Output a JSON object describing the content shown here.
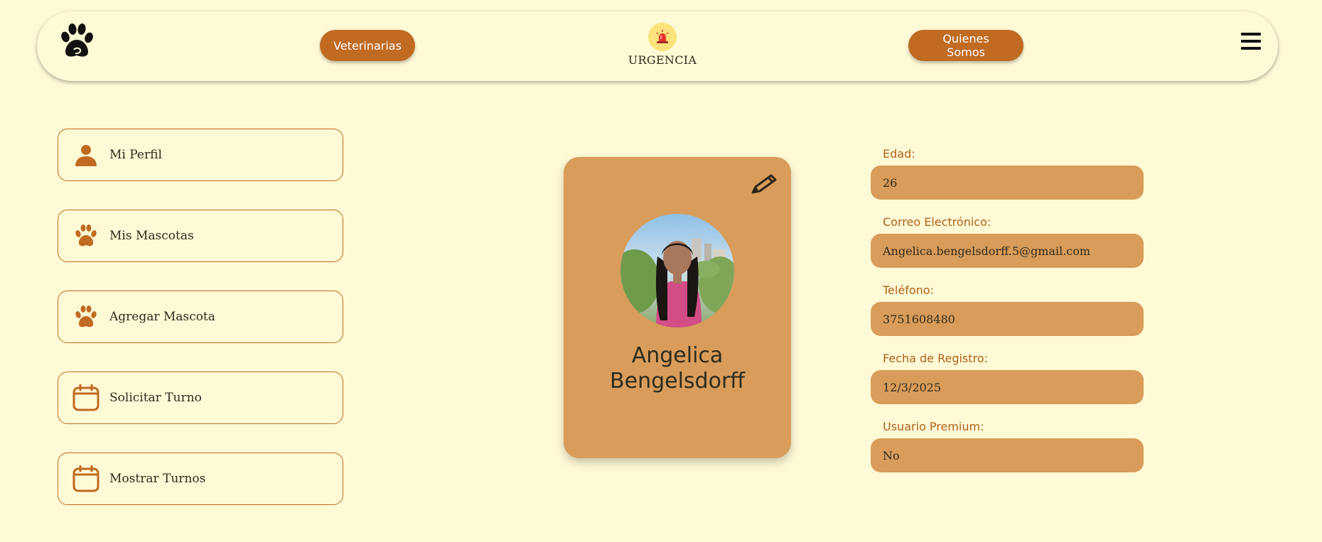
{
  "navbar": {
    "logo_icon": "paw-logo-icon",
    "veterinarias_label": "Veterinarias",
    "urgencia_label": "URGENCIA",
    "urgencia_icon": "siren-icon",
    "quienes_label": "Quienes Somos",
    "menu_icon": "hamburger-menu-icon"
  },
  "sidebar": {
    "items": [
      {
        "label": "Mi Perfil",
        "icon": "user-icon"
      },
      {
        "label": "Mis Mascotas",
        "icon": "paw-icon"
      },
      {
        "label": "Agregar Mascota",
        "icon": "paw-icon"
      },
      {
        "label": "Solicitar Turno",
        "icon": "calendar-icon"
      },
      {
        "label": "Mostrar Turnos",
        "icon": "calendar-icon"
      }
    ]
  },
  "profile": {
    "first_name": "Angelica",
    "last_name": "Bengelsdorff",
    "edit_icon": "pencil-icon",
    "avatar": "profile-photo"
  },
  "info": {
    "age_label": "Edad:",
    "age_value": "26",
    "email_label": "Correo Electrónico:",
    "email_value": "Angelica.bengelsdorff.5@gmail.com",
    "phone_label": "Teléfono:",
    "phone_value": "3751608480",
    "reg_label": "Fecha de Registro:",
    "reg_value": "12/3/2025",
    "premium_label": "Usuario Premium:",
    "premium_value": "No"
  },
  "colors": {
    "background": "#fffad6",
    "accent": "#c06a22",
    "card": "#d99c5a",
    "label": "#b0601c"
  }
}
